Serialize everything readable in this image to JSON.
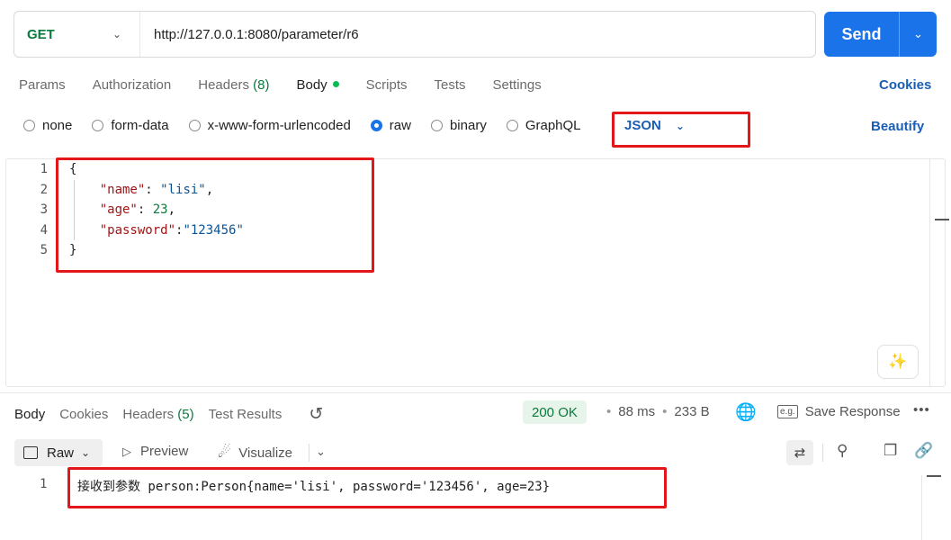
{
  "request": {
    "method": "GET",
    "url": "http://127.0.0.1:8080/parameter/r6",
    "send_label": "Send"
  },
  "request_tabs": [
    {
      "label": "Params"
    },
    {
      "label": "Authorization"
    },
    {
      "label": "Headers",
      "count": "(8)"
    },
    {
      "label": "Body"
    },
    {
      "label": "Scripts"
    },
    {
      "label": "Tests"
    },
    {
      "label": "Settings"
    }
  ],
  "cookies_label": "Cookies",
  "body_types": [
    "none",
    "form-data",
    "x-www-form-urlencoded",
    "raw",
    "binary",
    "GraphQL"
  ],
  "body_type_selected": "raw",
  "language": "JSON",
  "beautify_label": "Beautify",
  "editor": {
    "line_numbers": [
      "1",
      "2",
      "3",
      "4",
      "5"
    ],
    "lines": {
      "l1": "{",
      "l2_key": "\"name\"",
      "l2_sep": ": ",
      "l2_val": "\"lisi\"",
      "l2_end": ",",
      "l3_key": "\"age\"",
      "l3_sep": ": ",
      "l3_val": "23",
      "l3_end": ",",
      "l4_key": "\"password\"",
      "l4_sep": ":",
      "l4_val": "\"123456\"",
      "l5": "}"
    }
  },
  "response_tabs": [
    {
      "label": "Body"
    },
    {
      "label": "Cookies"
    },
    {
      "label": "Headers",
      "count": "(5)"
    },
    {
      "label": "Test Results"
    }
  ],
  "response": {
    "status": "200 OK",
    "time": "88 ms",
    "size": "233 B",
    "save_label": "Save Response",
    "save_icon_text": "e.g.",
    "format_label": "Raw",
    "preview_label": "Preview",
    "visualize_label": "Visualize",
    "line_number": "1",
    "text": "接收到参数 person:Person{name='lisi', password='123456', age=23}"
  },
  "colors": {
    "accent": "#1a73e8",
    "method_green": "#0a7a3d",
    "highlight_red": "#e3161b",
    "status_bg": "#e6f4ea"
  },
  "icons": [
    "chevron-down-icon",
    "history-icon",
    "globe-icon",
    "more-icon",
    "play-icon",
    "visualize-icon",
    "wrap-icon",
    "search-icon",
    "copy-icon",
    "link-icon",
    "magic-icon"
  ]
}
